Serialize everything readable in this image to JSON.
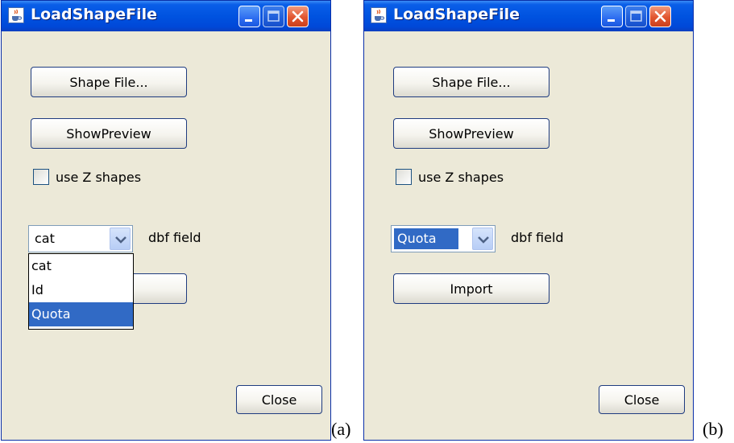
{
  "windows": [
    {
      "title": "LoadShapeFile",
      "shape_file_button": "Shape File...",
      "show_preview_button": "ShowPreview",
      "use_z_label": "use Z shapes",
      "combo_value": "cat",
      "dbf_label": "dbf field",
      "dropdown_open": true,
      "dropdown_options": [
        "cat",
        "Id",
        "Quota"
      ],
      "highlighted_option": "Quota",
      "close_button": "Close",
      "caption": "(a)"
    },
    {
      "title": "LoadShapeFile",
      "shape_file_button": "Shape File...",
      "show_preview_button": "ShowPreview",
      "use_z_label": "use Z shapes",
      "combo_value": "Quota",
      "dbf_label": "dbf field",
      "import_button": "Import",
      "close_button": "Close",
      "caption": "(b)"
    }
  ],
  "colors": {
    "titlebar": "#0053e0",
    "window_bg": "#ece9d8",
    "selection": "#316ac5",
    "close_btn": "#e2552f"
  },
  "icons": {
    "app": "java-cup-icon",
    "minimize": "minimize-icon",
    "maximize": "maximize-icon",
    "close": "close-icon",
    "combo_arrow": "chevron-down-icon"
  }
}
